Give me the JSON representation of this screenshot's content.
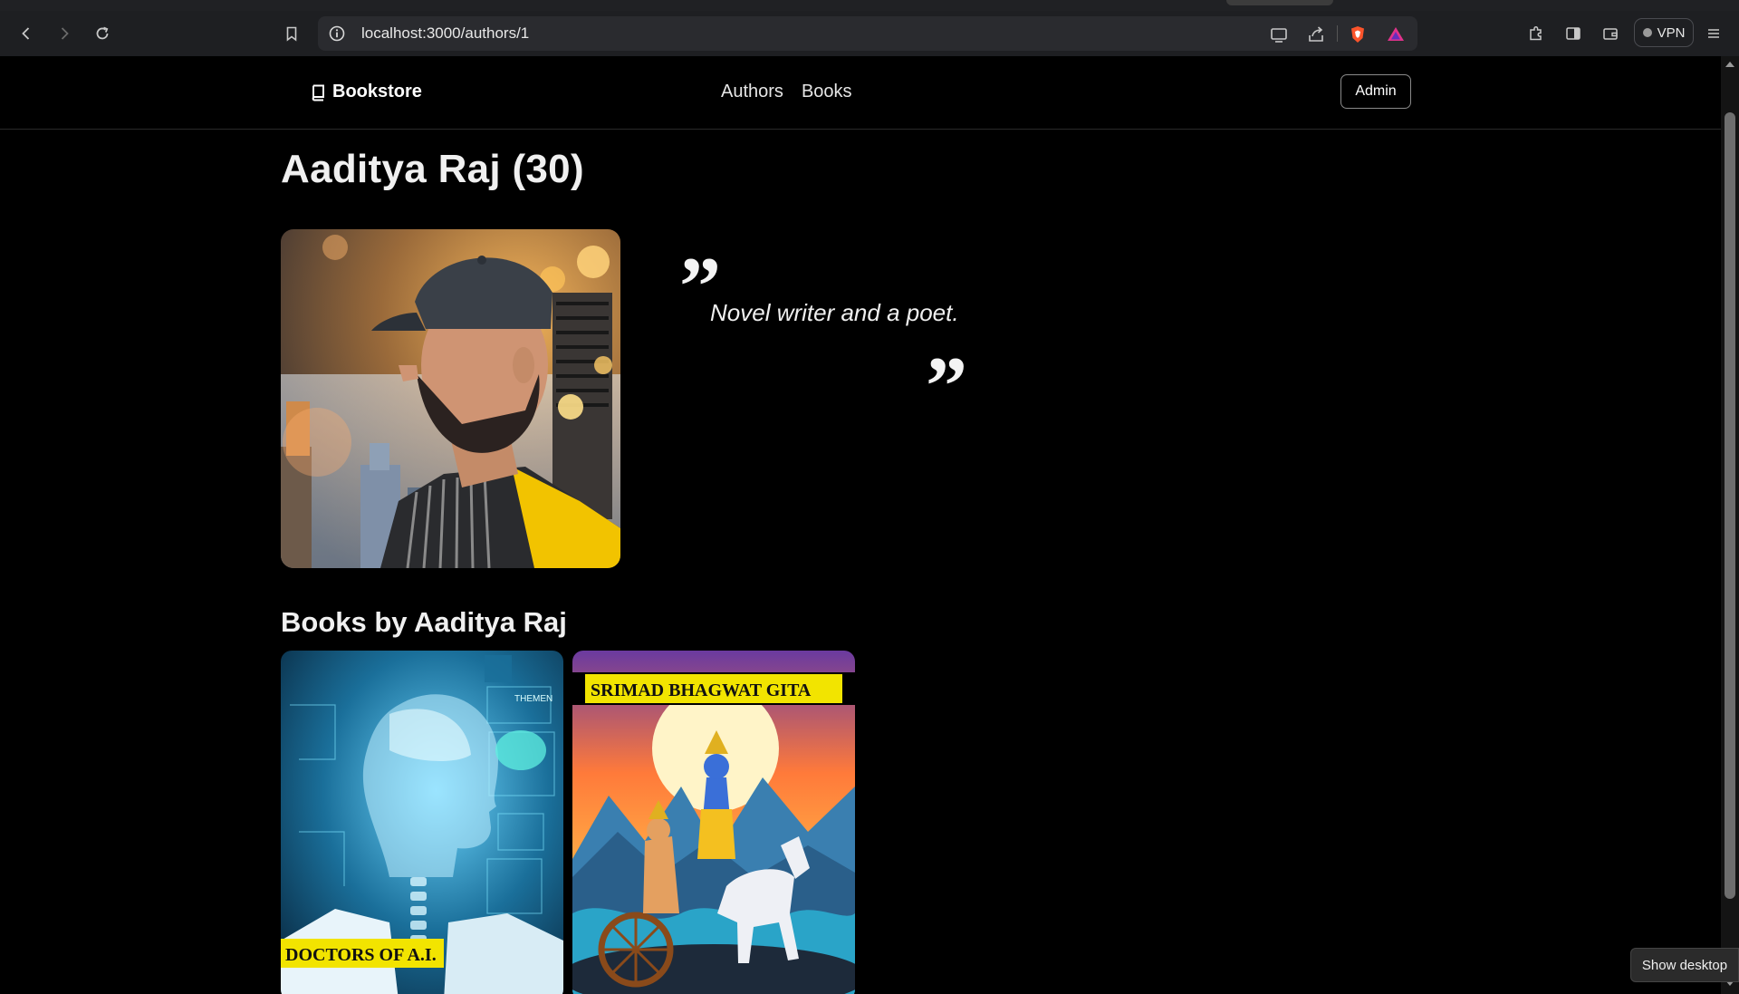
{
  "browser": {
    "url": "localhost:3000/authors/1",
    "vpn_label": "VPN"
  },
  "nav": {
    "brand": "Bookstore",
    "links": [
      "Authors",
      "Books"
    ],
    "admin_label": "Admin"
  },
  "author": {
    "title": "Aaditya Raj (30)",
    "bio": "Novel writer and a poet.",
    "quote_open": "”",
    "quote_close": "”"
  },
  "books_section": {
    "heading": "Books by Aaditya Raj",
    "books": [
      {
        "cover_text": "DOCTORS OF A.I.",
        "cover_small_text": "THEMEN"
      },
      {
        "cover_text": "SRIMAD BHAGWAT GITA"
      }
    ]
  },
  "taskbar": {
    "tooltip": "Show desktop"
  },
  "colors": {
    "page_bg": "#000000",
    "chrome_bg": "#1e1f22",
    "cover_title_bg": "#f2e400"
  }
}
